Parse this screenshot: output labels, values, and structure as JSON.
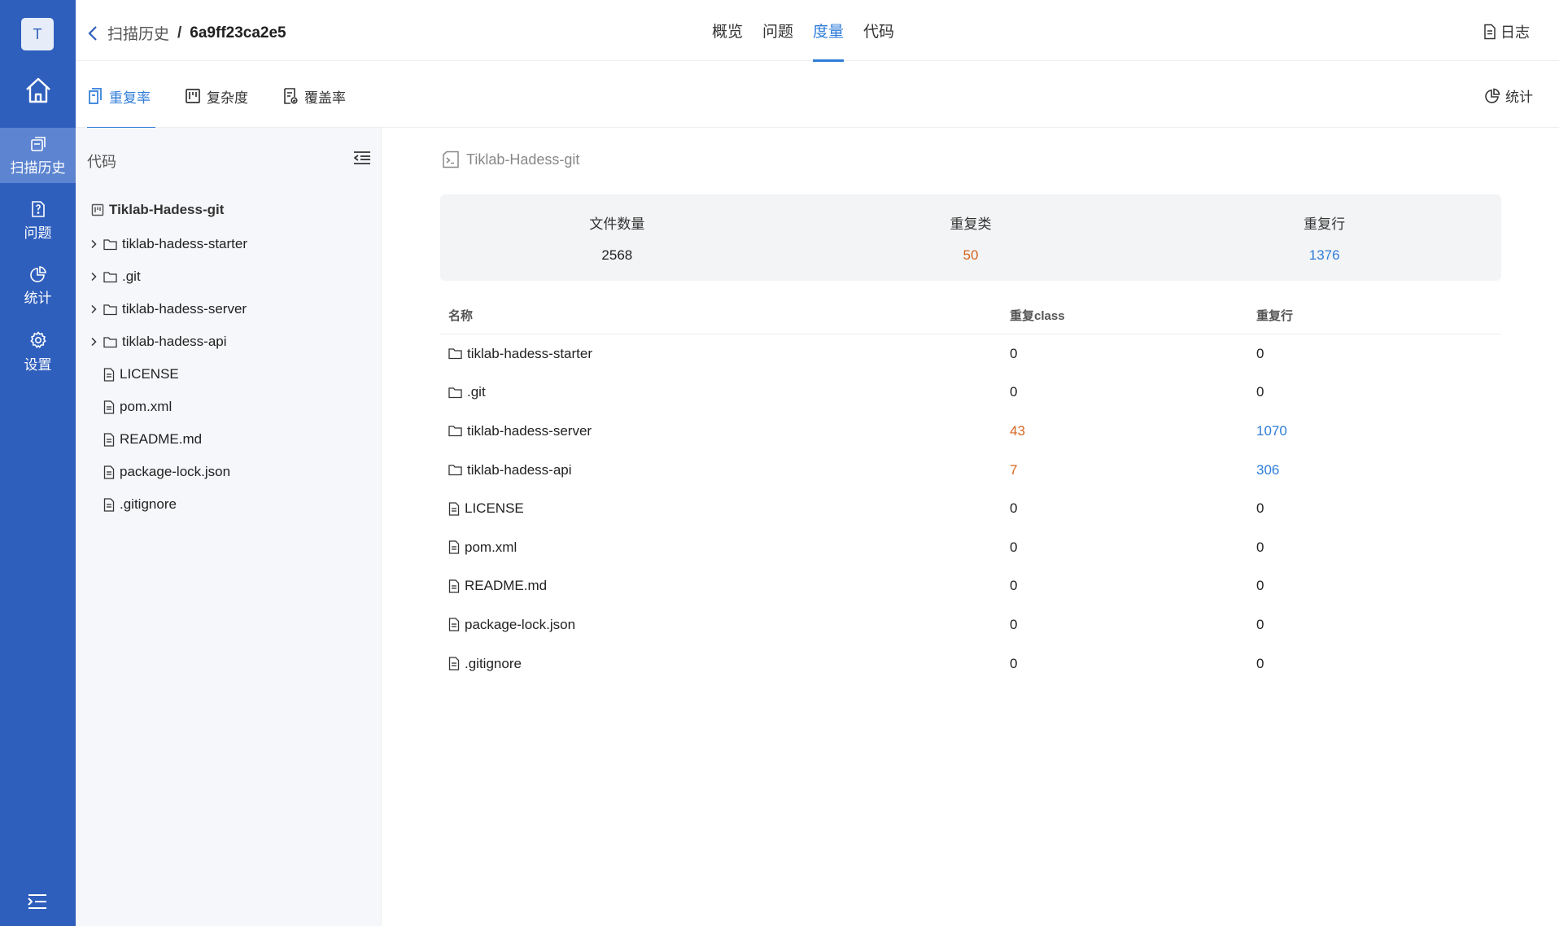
{
  "rail": {
    "avatar": "T",
    "items": [
      {
        "label": "扫描历史",
        "icon": "history-icon",
        "active": true
      },
      {
        "label": "问题",
        "icon": "issue-icon",
        "active": false
      },
      {
        "label": "统计",
        "icon": "pie-chart-icon",
        "active": false
      },
      {
        "label": "设置",
        "icon": "gear-icon",
        "active": false
      }
    ]
  },
  "header": {
    "breadcrumb_parent": "扫描历史",
    "breadcrumb_separator": "/",
    "breadcrumb_current": "6a9ff23ca2e5",
    "tabs": [
      "概览",
      "问题",
      "度量",
      "代码"
    ],
    "active_tab": "度量",
    "log_label": "日志"
  },
  "subtabs": {
    "items": [
      "重复率",
      "复杂度",
      "覆盖率"
    ],
    "active": "重复率",
    "stats_label": "统计"
  },
  "tree": {
    "title": "代码",
    "root": "Tiklab-Hadess-git",
    "nodes": [
      {
        "name": "tiklab-hadess-starter",
        "type": "folder"
      },
      {
        "name": ".git",
        "type": "folder"
      },
      {
        "name": "tiklab-hadess-server",
        "type": "folder"
      },
      {
        "name": "tiklab-hadess-api",
        "type": "folder"
      },
      {
        "name": "LICENSE",
        "type": "file"
      },
      {
        "name": "pom.xml",
        "type": "file"
      },
      {
        "name": "README.md",
        "type": "file"
      },
      {
        "name": "package-lock.json",
        "type": "file"
      },
      {
        "name": ".gitignore",
        "type": "file"
      }
    ]
  },
  "main": {
    "repo_title": "Tiklab-Hadess-git",
    "summary": [
      {
        "label": "文件数量",
        "value": "2568",
        "tone": "default"
      },
      {
        "label": "重复类",
        "value": "50",
        "tone": "warn"
      },
      {
        "label": "重复行",
        "value": "1376",
        "tone": "info"
      }
    ],
    "table": {
      "headers": [
        "名称",
        "重复class",
        "重复行"
      ],
      "rows": [
        {
          "name": "tiklab-hadess-starter",
          "type": "folder",
          "dup_class": "0",
          "dup_lines": "0"
        },
        {
          "name": ".git",
          "type": "folder",
          "dup_class": "0",
          "dup_lines": "0"
        },
        {
          "name": "tiklab-hadess-server",
          "type": "folder",
          "dup_class": "43",
          "dup_lines": "1070"
        },
        {
          "name": "tiklab-hadess-api",
          "type": "folder",
          "dup_class": "7",
          "dup_lines": "306"
        },
        {
          "name": "LICENSE",
          "type": "file",
          "dup_class": "0",
          "dup_lines": "0"
        },
        {
          "name": "pom.xml",
          "type": "file",
          "dup_class": "0",
          "dup_lines": "0"
        },
        {
          "name": "README.md",
          "type": "file",
          "dup_class": "0",
          "dup_lines": "0"
        },
        {
          "name": "package-lock.json",
          "type": "file",
          "dup_class": "0",
          "dup_lines": "0"
        },
        {
          "name": ".gitignore",
          "type": "file",
          "dup_class": "0",
          "dup_lines": "0"
        }
      ]
    }
  },
  "colors": {
    "rail": "#2f5fbd",
    "accent": "#2f7dd9",
    "warn": "#d4661f",
    "info": "#2f7dd9"
  }
}
